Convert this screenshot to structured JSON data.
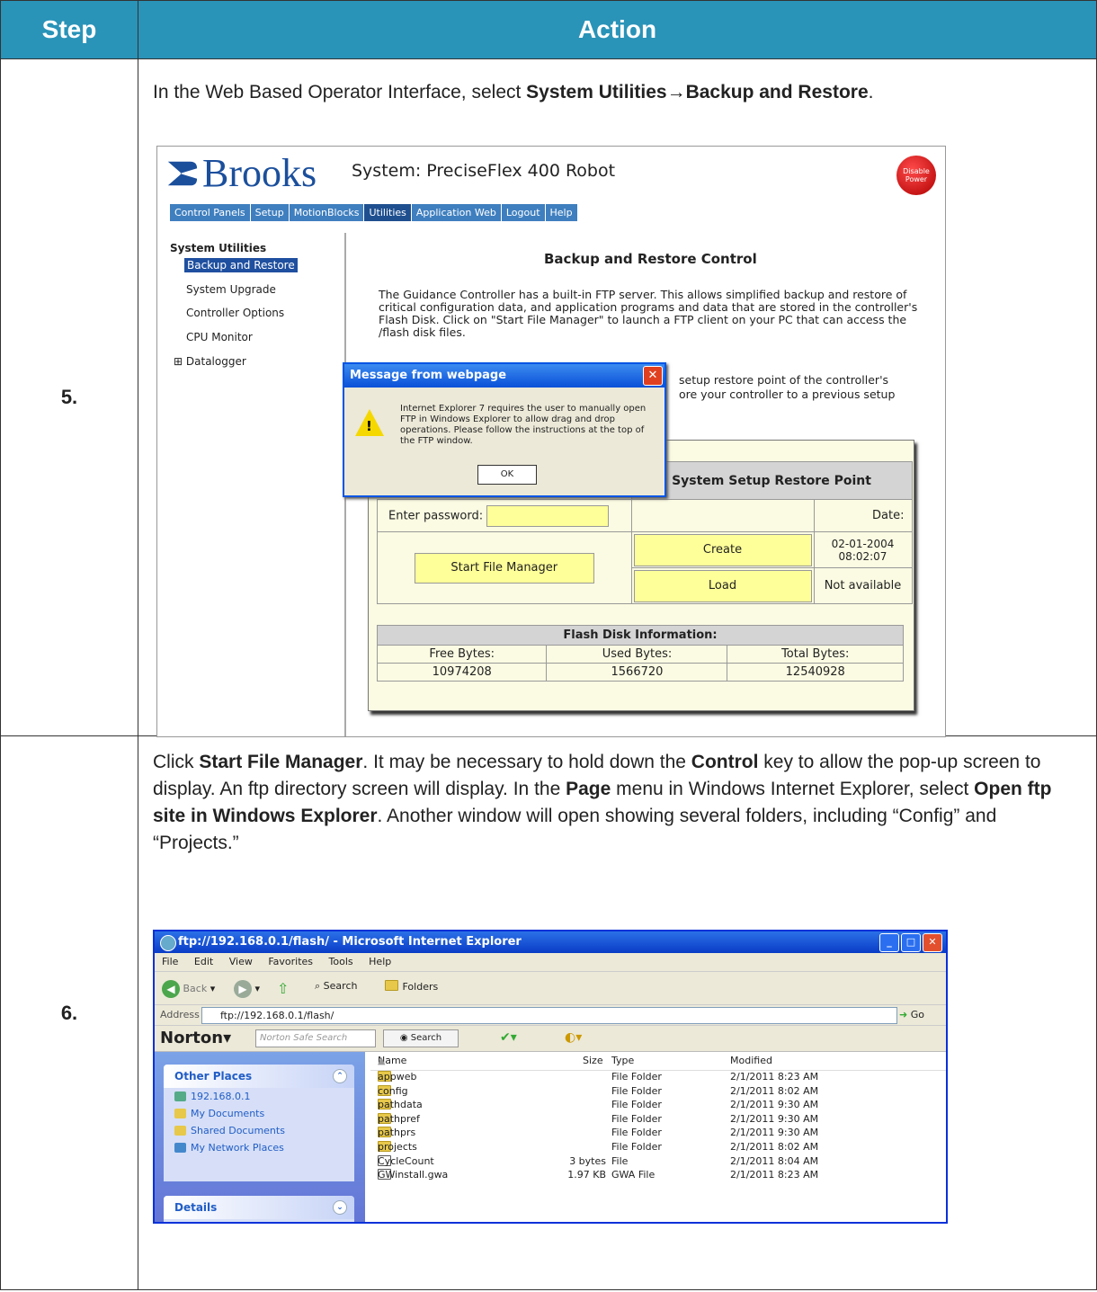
{
  "table": {
    "header_step": "Step",
    "header_action": "Action"
  },
  "step5": {
    "number": "5.",
    "text_prefix": "In the Web Based Operator Interface, select ",
    "text_bold": "System Utilities→Backup and Restore",
    "text_suffix": ".",
    "screenshot": {
      "brand": "Brooks",
      "system_title": "System: PreciseFlex 400 Robot",
      "disable_power": "Disable Power",
      "nav": [
        "Control Panels",
        "Setup",
        "MotionBlocks",
        "Utilities",
        "Application Web",
        "Logout",
        "Help"
      ],
      "sidebar_title": "System Utilities",
      "sidebar_items": [
        "Backup and Restore",
        "System Upgrade",
        "Controller Options",
        "CPU Monitor",
        "Datalogger"
      ],
      "main_title": "Backup and Restore Control",
      "main_para": "The Guidance Controller has a built-in FTP server. This allows simplified backup and restore of critical configuration data, and application programs and data that are stored in the controller's Flash Disk.  Click on \"Start File Manager\" to launch a FTP client on your PC that can access the /flash disk files.",
      "main_para2_line1": "setup restore point of the controller's",
      "main_para2_line2": "ore your controller to a previous setup",
      "dialog_title": "Message from webpage",
      "dialog_text": "Internet Explorer 7 requires the user to manually open FTP in Windows Explorer to allow drag and drop operations. Please follow the instructions at the top of the FTP window.",
      "dialog_ok": "OK",
      "restore_header": "System Setup Restore Point",
      "password_label": "Enter password:",
      "date_label": "Date:",
      "start_btn": "Start File Manager",
      "create_btn": "Create",
      "load_btn": "Load",
      "date_value": "02-01-2004 08:02:07",
      "not_available": "Not available",
      "flash_header": "Flash Disk Information:",
      "free_label": "Free Bytes:",
      "used_label": "Used Bytes:",
      "total_label": "Total Bytes:",
      "free_value": "10974208",
      "used_value": "1566720",
      "total_value": "12540928"
    }
  },
  "step6": {
    "number": "6.",
    "t1": "Click ",
    "b1": "Start File Manager",
    "t2": ". It may be necessary to hold down the ",
    "b2": "Control",
    "t3": " key to allow the pop-up screen to display. An ftp directory screen will display. In the ",
    "b3": "Page",
    "t4": " menu in Windows Internet Explorer, select ",
    "b4": "Open ftp site in Windows Explorer",
    "t5": ". Another window will open showing several folders, including “Config” and “Projects.”",
    "screenshot": {
      "window_title": "ftp://192.168.0.1/flash/ - Microsoft Internet Explorer",
      "menu": [
        "File",
        "Edit",
        "View",
        "Favorites",
        "Tools",
        "Help"
      ],
      "back": "Back",
      "search": "Search",
      "folders": "Folders",
      "address_label": "Address",
      "address_value": "ftp://192.168.0.1/flash/",
      "go": "Go",
      "norton": "Norton",
      "norton_placeholder": "Norton Safe Search",
      "norton_search": "Search",
      "other_places": "Other Places",
      "places": [
        "192.168.0.1",
        "My Documents",
        "Shared Documents",
        "My Network Places"
      ],
      "details": "Details",
      "columns": [
        "Name",
        "Size",
        "Type",
        "Modified"
      ],
      "files": [
        {
          "name": "appweb",
          "size": "",
          "type": "File Folder",
          "modified": "2/1/2011 8:23 AM"
        },
        {
          "name": "config",
          "size": "",
          "type": "File Folder",
          "modified": "2/1/2011 8:02 AM"
        },
        {
          "name": "pathdata",
          "size": "",
          "type": "File Folder",
          "modified": "2/1/2011 9:30 AM"
        },
        {
          "name": "pathpref",
          "size": "",
          "type": "File Folder",
          "modified": "2/1/2011 9:30 AM"
        },
        {
          "name": "pathprs",
          "size": "",
          "type": "File Folder",
          "modified": "2/1/2011 9:30 AM"
        },
        {
          "name": "projects",
          "size": "",
          "type": "File Folder",
          "modified": "2/1/2011 8:02 AM"
        },
        {
          "name": "CycleCount",
          "size": "3 bytes",
          "type": "File",
          "modified": "2/1/2011 8:04 AM"
        },
        {
          "name": "GWinstall.gwa",
          "size": "1.97 KB",
          "type": "GWA File",
          "modified": "2/1/2011 8:23 AM"
        }
      ]
    }
  }
}
